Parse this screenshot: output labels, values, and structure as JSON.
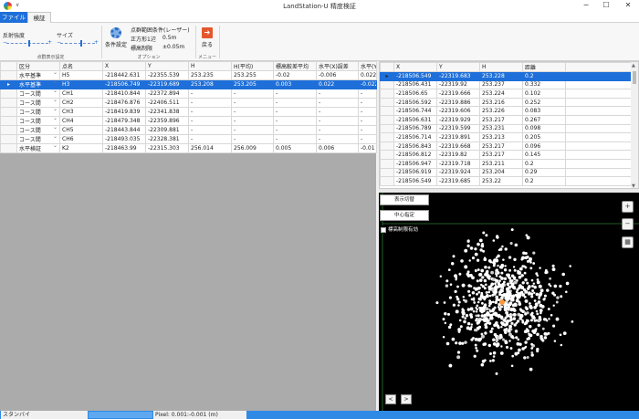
{
  "window": {
    "title": "LandStation-U 精度検証",
    "minimize": "─",
    "maximize": "☐",
    "close": "✕"
  },
  "tabs": [
    {
      "label": "ファイル"
    },
    {
      "label": "検証"
    }
  ],
  "ribbon": {
    "reflect_label": "反射強度",
    "size_label": "サイズ",
    "pointcloud_caption": "点群表示設定",
    "condition_button": "条件設定",
    "range_title": "点群範囲条件(レーザー)",
    "square_label": "正方形1辺",
    "square_value": "0.5m",
    "elev_label": "標高制限",
    "elev_value": "±0.05m",
    "option_caption": "オプション",
    "back_button": "戻る",
    "menu_caption": "メニュー",
    "reflect_level": 0.55,
    "size_level": 0.6
  },
  "left_table": {
    "headers": [
      "区分",
      "点名",
      "X",
      "Y",
      "H",
      "H(平均)",
      "標高較差平均",
      "水平(X)誤差",
      "水平(Y"
    ],
    "rows": [
      [
        "水平基準",
        "H5",
        "-218442.631",
        "-22355.539",
        "253.235",
        "253.255",
        "-0.02",
        "-0.006",
        "0.022"
      ],
      [
        "水平基準",
        "H3",
        "-218506.749",
        "-22319.689",
        "253.208",
        "253.205",
        "0.003",
        "0.022",
        "-0.022"
      ],
      [
        "コース間",
        "CH1",
        "-218410.844",
        "-22372.894",
        "-",
        "-",
        "-",
        "-",
        "-"
      ],
      [
        "コース間",
        "CH2",
        "-218476.876",
        "-22406.511",
        "-",
        "-",
        "-",
        "-",
        "-"
      ],
      [
        "コース間",
        "CH3",
        "-218419.839",
        "-22341.838",
        "-",
        "-",
        "-",
        "-",
        "-"
      ],
      [
        "コース間",
        "CH4",
        "-218479.348",
        "-22359.896",
        "-",
        "-",
        "-",
        "-",
        "-"
      ],
      [
        "コース間",
        "CH5",
        "-218443.844",
        "-22309.881",
        "-",
        "-",
        "-",
        "-",
        "-"
      ],
      [
        "コース間",
        "CH6",
        "-218493.035",
        "-22328.381",
        "-",
        "-",
        "-",
        "-",
        "-"
      ],
      [
        "水平検証",
        "K2",
        "-218463.99",
        "-22315.303",
        "256.014",
        "256.009",
        "0.005",
        "0.006",
        "-0.01"
      ]
    ]
  },
  "right_table": {
    "headers": [
      "X",
      "Y",
      "H",
      "距離"
    ],
    "rows": [
      [
        "-218506.549",
        "-22319.683",
        "253.228",
        "0.2"
      ],
      [
        "-218506.431",
        "-22319.92",
        "253.237",
        "0.332"
      ],
      [
        "-218506.65",
        "-22319.666",
        "253.224",
        "0.102"
      ],
      [
        "-218506.592",
        "-22319.886",
        "253.216",
        "0.252"
      ],
      [
        "-218506.744",
        "-22319.606",
        "253.226",
        "0.083"
      ],
      [
        "-218506.631",
        "-22319.929",
        "253.217",
        "0.267"
      ],
      [
        "-218506.789",
        "-22319.599",
        "253.231",
        "0.098"
      ],
      [
        "-218506.714",
        "-22319.891",
        "253.213",
        "0.205"
      ],
      [
        "-218506.843",
        "-22319.668",
        "253.217",
        "0.096"
      ],
      [
        "-218506.812",
        "-22319.82",
        "253.217",
        "0.145"
      ],
      [
        "-218506.947",
        "-22319.718",
        "253.211",
        "0.2"
      ],
      [
        "-218506.919",
        "-22319.924",
        "253.204",
        "0.29"
      ],
      [
        "-218506.549",
        "-22319.685",
        "253.22",
        "0.2"
      ]
    ]
  },
  "plot": {
    "display_toggle": "表示切替",
    "center_button": "中心指定",
    "elev_limit_checkbox": "標高制限有効",
    "zoom_in": "+",
    "zoom_out": "−",
    "fit": "▦",
    "prev": "<",
    "next": ">"
  },
  "status": {
    "text": "スタンバイ",
    "pixel": "Pixel: 0.001:-0.001 (m)"
  },
  "colors": {
    "accent": "#1e6fd9",
    "status_bar": "#2f8ae5",
    "points": "#ffffff",
    "marker": "#ff9a3c"
  }
}
